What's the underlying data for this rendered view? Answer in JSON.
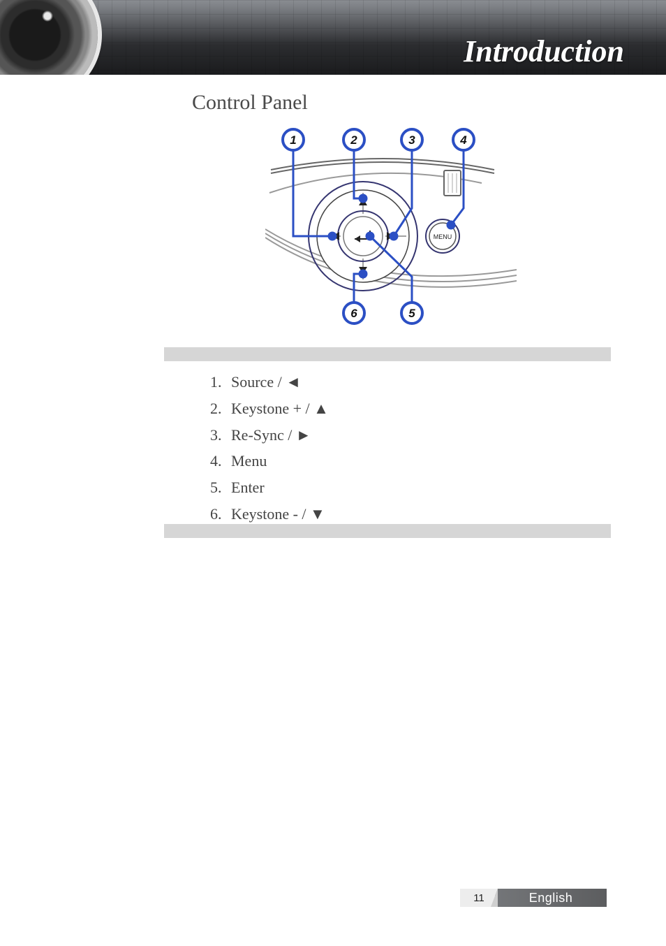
{
  "header": {
    "title": "Introduction"
  },
  "section": {
    "heading": "Control Panel"
  },
  "diagram": {
    "menu_button_label": "MENU",
    "callouts": [
      {
        "n": "1"
      },
      {
        "n": "2"
      },
      {
        "n": "3"
      },
      {
        "n": "4"
      },
      {
        "n": "5"
      },
      {
        "n": "6"
      }
    ]
  },
  "legend": [
    {
      "text": "Source / ◄"
    },
    {
      "text": "Keystone + / ▲"
    },
    {
      "text": "Re-Sync / ►"
    },
    {
      "text": "Menu"
    },
    {
      "text": "Enter"
    },
    {
      "text": "Keystone - / ▼"
    }
  ],
  "footer": {
    "page": "11",
    "language": "English"
  }
}
